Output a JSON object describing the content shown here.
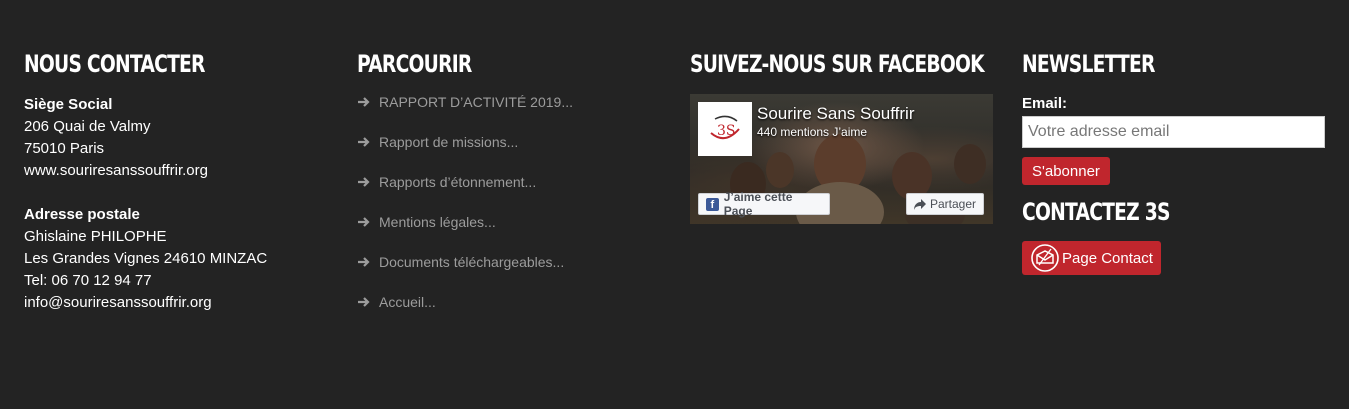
{
  "contact": {
    "title": "NOUS CONTACTER",
    "seat_label": "Siège Social",
    "seat_lines": [
      "206 Quai de Valmy",
      "75010 Paris",
      "www.souriresanssouffrir.org"
    ],
    "postal_label": "Adresse postale",
    "postal_lines": [
      "Ghislaine PHILOPHE",
      "Les Grandes Vignes 24610 MINZAC",
      "Tel: 06 70 12 94 77",
      "info@souriresanssouffrir.org"
    ]
  },
  "browse": {
    "title": "PARCOURIR",
    "links": [
      "RAPPORT D’ACTIVITÉ 2019...",
      "Rapport de missions...",
      "Rapports d’étonnement...",
      "Mentions légales...",
      "Documents téléchargeables...",
      "Accueil..."
    ]
  },
  "facebook": {
    "title": "SUIVEZ-NOUS SUR FACEBOOK",
    "page_name": "Sourire Sans Souffrir",
    "likes": "440 mentions J’aime",
    "like_button": "J’aime cette Page",
    "share_button": "Partager",
    "logo_text": "3S"
  },
  "newsletter": {
    "title": "NEWSLETTER",
    "email_label": "Email:",
    "email_placeholder": "Votre adresse email",
    "subscribe_button": "S'abonner"
  },
  "contact3s": {
    "title": "CONTACTEZ 3S",
    "button": "Page Contact"
  },
  "colors": {
    "background": "#232323",
    "accent_red": "#c0262d",
    "link_gray": "#9c9c9c",
    "facebook_blue": "#3b5998"
  }
}
